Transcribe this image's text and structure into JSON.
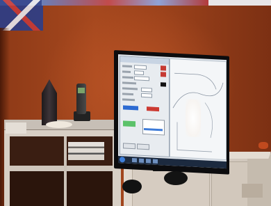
{
  "scene": {
    "palette": {
      "wall": "#9c421b",
      "furniture": "#d7cfc5",
      "tv_bezel": "#0c0c0e",
      "screen": "#dfe4ea",
      "taskbar": "#1c2a3f",
      "swatch_red": "#c63a33",
      "swatch_blue": "#2d6bd2",
      "swatch_green": "#5cc26a"
    }
  }
}
